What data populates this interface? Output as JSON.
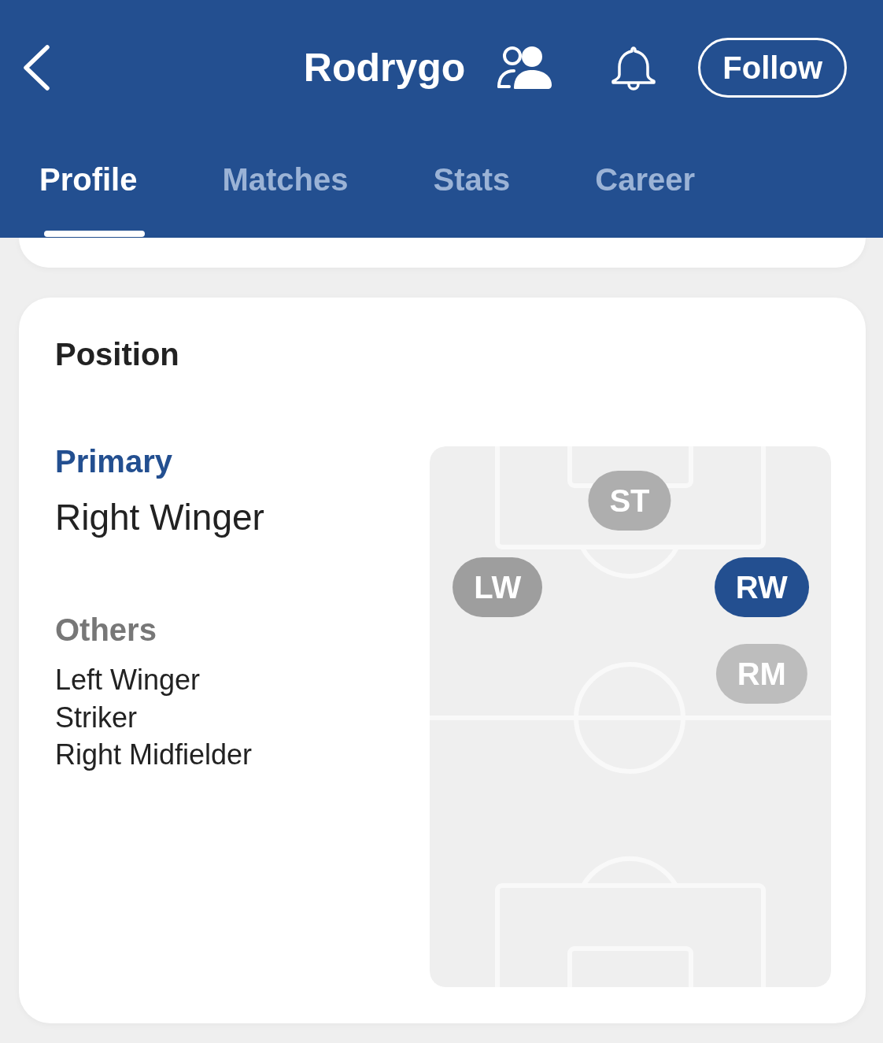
{
  "header": {
    "title": "Rodrygo",
    "follow_button": "Follow"
  },
  "tabs": [
    {
      "label": "Profile",
      "selected": true
    },
    {
      "label": "Matches",
      "selected": false
    },
    {
      "label": "Stats",
      "selected": false
    },
    {
      "label": "Career",
      "selected": false
    }
  ],
  "position_card": {
    "title": "Position",
    "primary": {
      "label": "Primary",
      "value": "Right Winger"
    },
    "others": {
      "label": "Others",
      "items": [
        "Left Winger",
        "Striker",
        "Right Midfielder"
      ]
    },
    "pitch": {
      "positions": [
        {
          "label": "ST",
          "color": "#aeaeae"
        },
        {
          "label": "LW",
          "color": "#9e9e9e"
        },
        {
          "label": "RW",
          "color": "#234f90"
        },
        {
          "label": "RM",
          "color": "#bdbdbd"
        }
      ]
    }
  }
}
